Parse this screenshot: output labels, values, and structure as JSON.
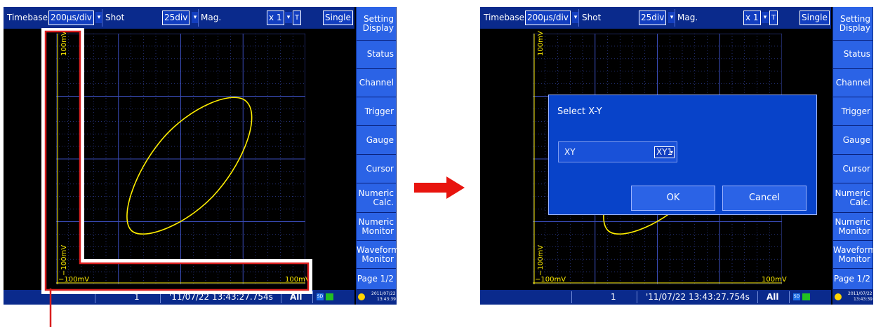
{
  "topbar": {
    "timebase_label": "Timebase",
    "timebase_value": "200μs/div",
    "shot_label": "Shot",
    "shot_value": "25div",
    "mag_label": "Mag.",
    "mag_value": "x 1",
    "trigger_mode_icon": "T",
    "mode_value": "Single"
  },
  "sidebar": {
    "setting_display": [
      "Setting",
      "Display"
    ],
    "status": "Status",
    "channel": "Channel",
    "trigger": "Trigger",
    "gauge": "Gauge",
    "cursor": "Cursor",
    "numeric_calc": [
      "Numeric",
      "Calc."
    ],
    "numeric_monitor": [
      "Numeric",
      "Monitor"
    ],
    "waveform_monitor": [
      "Waveform",
      "Monitor"
    ],
    "page": "Page 1/2"
  },
  "plot": {
    "y_top": "100mV",
    "y_bottom": "−100mV",
    "x_left": "−100mV",
    "x_right": "100mV",
    "trace_color": "#ffee00",
    "grid_color": "#3a4cb8"
  },
  "statusbar": {
    "count": "1",
    "datetime": "'11/07/22  13:43:27.754s",
    "channel_scope": "All",
    "sd_icon": "SD",
    "clock": [
      "2011/07/22",
      "13:43:39"
    ]
  },
  "dialog": {
    "title": "Select X-Y",
    "field_label": "XY",
    "field_value": "XY1",
    "ok_label": "OK",
    "cancel_label": "Cancel"
  },
  "colors": {
    "highlight": "#d91f1f",
    "arrow": "#e8140e",
    "panel_blue": "#2b63e6",
    "dialog_blue": "#0843c9"
  }
}
